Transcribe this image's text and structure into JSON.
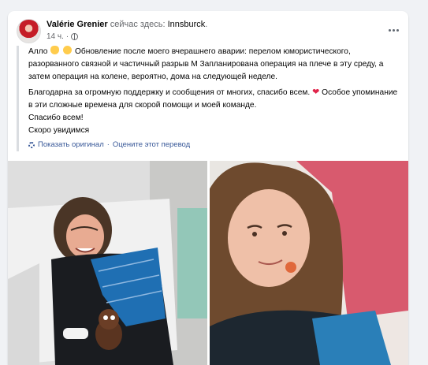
{
  "post": {
    "author": "Valérie Grenier",
    "location_prefix": "сейчас здесь:",
    "location": "Innsburck",
    "location_suffix": ".",
    "time": "14 ч.",
    "separator": "·",
    "body": {
      "p1_start": "Алло",
      "p1_rest": "Обновление после моего вчерашнего аварии: перелом юмористического, разорванного связной и частичный разрыв M Запланирована операция на плече в эту среду, а затем операция на колене, вероятно, дома на следующей неделе.",
      "p2_start": "Благодарна за огромную поддержку и сообщения от многих, спасибо всем.",
      "p2_rest": "Особое упоминание в эти сложные времена для скорой помощи и моей команде.",
      "p2_line2": "Спасибо всем!",
      "p2_line3": "Скоро увидимся"
    },
    "translation": {
      "show_original": "Показать оригинал",
      "dot": "·",
      "rate": "Оцените этот перевод"
    }
  },
  "icons": {
    "globe": "globe-icon",
    "more": "more-options-icon",
    "gear": "gear-icon",
    "wave": "waving-hand-emoji",
    "sad": "sad-face-emoji",
    "heart": "red-heart-emoji"
  },
  "colors": {
    "link": "#385898",
    "meta": "#65676b",
    "heart": "#e0244a",
    "sling": "#1f6fb3",
    "hospital_background": "#d8566a"
  }
}
